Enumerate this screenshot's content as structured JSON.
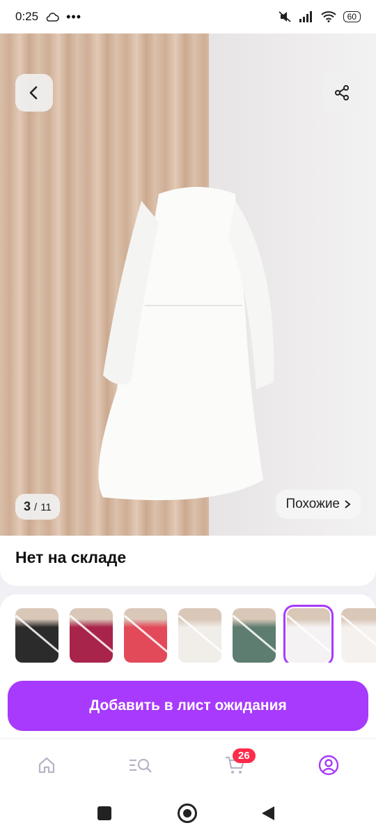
{
  "status_bar": {
    "time": "0:25",
    "battery": "60"
  },
  "gallery": {
    "current": "3",
    "separator": "/",
    "total": "11",
    "similar_label": "Похожие"
  },
  "product": {
    "stock_status": "Нет на складе"
  },
  "variants": [
    {
      "color": "#2b2b2b",
      "selected": false,
      "available": false
    },
    {
      "color": "#a8244a",
      "selected": false,
      "available": false
    },
    {
      "color": "#e24a5a",
      "selected": false,
      "available": false
    },
    {
      "color": "#f1ede8",
      "selected": false,
      "available": false
    },
    {
      "color": "#5d7d70",
      "selected": false,
      "available": false
    },
    {
      "color": "#f4f2f2",
      "selected": true,
      "available": false
    },
    {
      "color": "#f5f1ee",
      "selected": false,
      "available": false
    }
  ],
  "actions": {
    "add_waitlist": "Добавить в лист ожидания"
  },
  "tabbar": {
    "cart_count": "26"
  },
  "colors": {
    "accent": "#a73afd",
    "badge": "#ff2b4a"
  },
  "icons": [
    "back-arrow-icon",
    "share-icon",
    "chevron-right-icon",
    "home-icon",
    "catalog-search-icon",
    "cart-icon",
    "profile-icon"
  ]
}
